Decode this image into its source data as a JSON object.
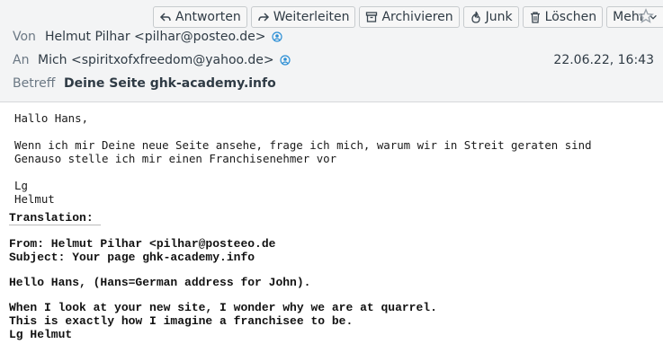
{
  "toolbar": {
    "reply": "Antworten",
    "forward": "Weiterleiten",
    "archive": "Archivieren",
    "junk": "Junk",
    "delete": "Löschen",
    "more": "Mehr"
  },
  "header": {
    "from_label": "Von",
    "from_value": "Helmut Pilhar <pilhar@posteo.de>",
    "to_label": "An",
    "to_value": "Mich <spiritxofxfreedom@yahoo.de>",
    "date": "22.06.22, 16:43",
    "subject_label": "Betreff",
    "subject_value": "Deine Seite ghk-academy.info"
  },
  "body": {
    "greeting": "Hallo Hans,",
    "line1": "Wenn ich mir Deine neue Seite ansehe, frage ich mich, warum wir in Streit geraten sind",
    "line2": "Genauso stelle ich mir einen Franchisenehmer vor",
    "closing1": "Lg",
    "closing2": "Helmut"
  },
  "translation": {
    "title": "Translation:",
    "from": "From: Helmut Pilhar <pilhar@posteeo.de",
    "subject": "Subject: Your page ghk-academy.info",
    "greeting": "Hello Hans, (Hans=German address for John).",
    "line1": "When I look at your new site, I wonder why we are at quarrel.",
    "line2": "This is exactly how I imagine a franchisee to be.",
    "closing": "Lg Helmut"
  }
}
